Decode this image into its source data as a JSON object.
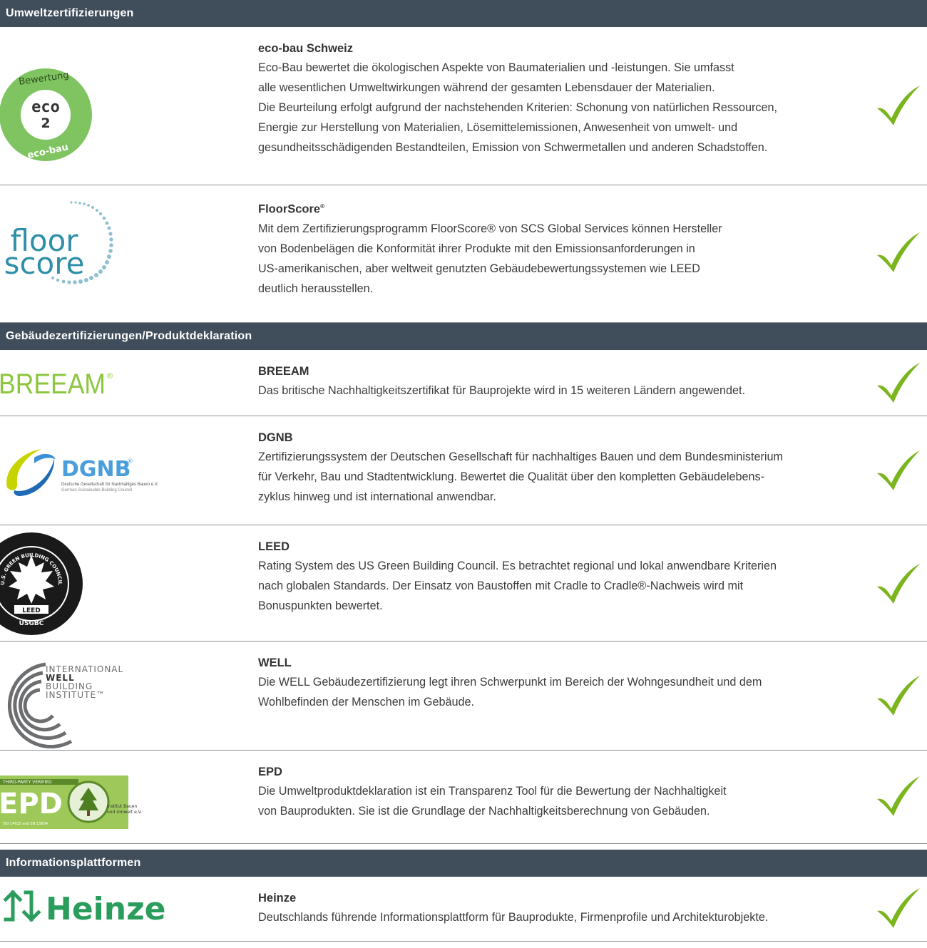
{
  "sections": [
    {
      "title": "Umweltzertifizierungen"
    },
    {
      "title": "Gebäudezertifizierungen/Produktdeklaration"
    },
    {
      "title": "Informationsplattformen"
    }
  ],
  "items": [
    {
      "name": "eco-bau Schweiz",
      "lines": [
        "Eco-Bau bewertet die ökologischen Aspekte von Baumaterialien und -leistungen. Sie umfasst",
        "alle wesentlichen Umweltwirkungen während der gesamten Lebensdauer der Materialien.",
        "Die Beurteilung erfolgt aufgrund der nachstehenden Kriterien: Schonung von natürlichen Ressourcen,",
        "Energie zur Herstellung von Materialien, Lösemittelemissionen, Anwesenheit von umwelt- und",
        "gesundheitsschädigenden Bestandteilen, Emission von Schwermetallen und anderen Schadstoffen."
      ],
      "logo_text": {
        "top": "Bewertung",
        "center1": "eco",
        "center2": "2",
        "bottom": "eco-bau"
      }
    },
    {
      "name": "FloorScore",
      "name_mark": "®",
      "lines": [
        "Mit dem Zertifizierungsprogramm FloorScore® von SCS Global Services können Hersteller",
        "von Bodenbelägen die Konformität ihrer Produkte mit den Emissionsanforderungen in",
        "US-amerikanischen, aber weltweit genutzten Gebäudebewertungssystemen wie LEED",
        "deutlich herausstellen."
      ],
      "logo_text": {
        "line1": "floor",
        "line2": "score"
      }
    },
    {
      "name": "BREEAM",
      "lines": [
        "Das britische Nachhaltigkeitszertifikat für Bauprojekte wird in 15 weiteren Ländern angewendet."
      ],
      "logo_text": {
        "main": "BREEAM",
        "mark": "®"
      }
    },
    {
      "name": "DGNB",
      "lines": [
        "Zertifizierungssystem der Deutschen Gesellschaft für nachhaltiges Bauen und dem Bundesministerium",
        "für Verkehr, Bau und Stadtentwicklung. Bewertet die Qualität über den kompletten Gebäudelebens-",
        "zyklus hinweg und ist international anwendbar."
      ],
      "logo_text": {
        "main": "DGNB",
        "mark": "®",
        "sub1": "Deutsche Gesellschaft für Nachhaltiges Bauen e.V.",
        "sub2": "German Sustainable Building Council"
      }
    },
    {
      "name": "LEED",
      "lines": [
        "Rating System des US Green Building Council. Es betrachtet regional und lokal anwendbare Kriterien",
        "nach globalen Standards. Der Einsatz von Baustoffen mit Cradle to Cradle®-Nachweis wird mit",
        "Bonuspunkten bewertet."
      ],
      "logo_text": {
        "ring": "U.S. GREEN BUILDING COUNCIL",
        "band": "LEED",
        "bottom": "USGBC"
      }
    },
    {
      "name": "WELL",
      "lines": [
        "Die WELL Gebäudezertifizierung legt ihren Schwerpunkt im Bereich der Wohngesundheit und dem",
        "Wohlbefinden der Menschen im Gebäude."
      ],
      "logo_text": {
        "l1": "INTERNATIONAL",
        "l2": "WELL",
        "l3": "BUILDING",
        "l4": "INSTITUTE™"
      }
    },
    {
      "name": "EPD",
      "lines": [
        "Die Umweltproduktdeklaration ist ein Transparenz Tool für die Bewertung der Nachhaltigkeit",
        "von Bauprodukten. Sie ist die Grundlage der Nachhaltigkeitsberechnung von Gebäuden."
      ],
      "logo_text": {
        "main": "EPD",
        "top": "THIRD-PARTY VERIFIED",
        "bottom": "ISO 14025 and EN 15804",
        "side1": "Institut Bauen",
        "side2": "und Umwelt e.V."
      }
    },
    {
      "name": "Heinze",
      "lines": [
        "Deutschlands führende Informationsplattform für Bauprodukte, Firmenprofile und Architekturobjekte."
      ],
      "logo_text": {
        "main": "Heinze"
      }
    }
  ],
  "colors": {
    "header_bg": "#404d5b",
    "check": "#7ab51d",
    "divider": "#8b8f94"
  },
  "icons": {
    "check": "checkmark-icon"
  }
}
